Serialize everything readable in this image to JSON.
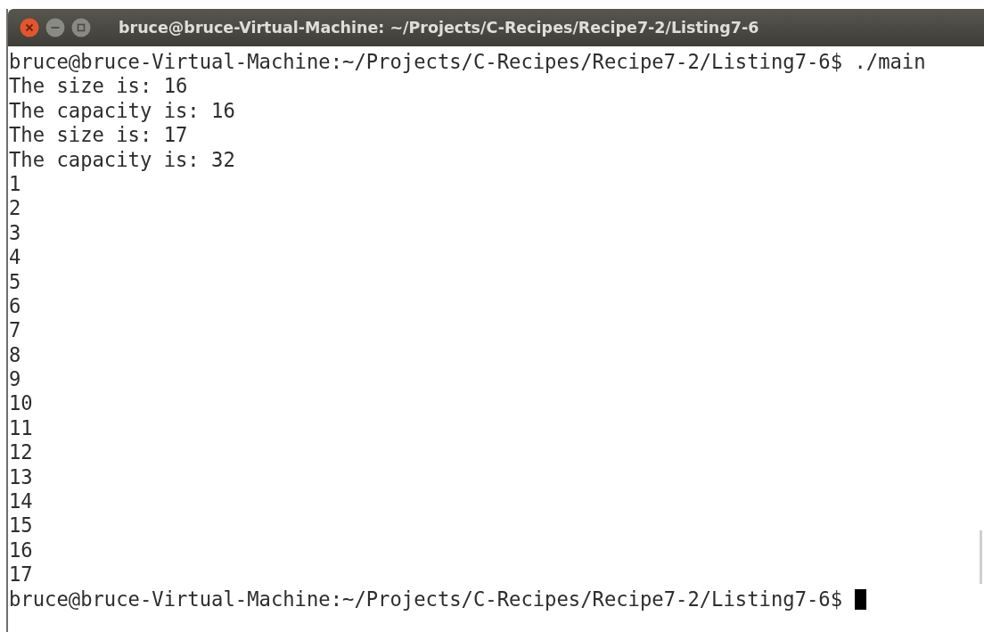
{
  "window": {
    "title": "bruce@bruce-Virtual-Machine: ~/Projects/C-Recipes/Recipe7-2/Listing7-6"
  },
  "terminal": {
    "lines": [
      "bruce@bruce-Virtual-Machine:~/Projects/C-Recipes/Recipe7-2/Listing7-6$ ./main",
      "The size is: 16",
      "The capacity is: 16",
      "The size is: 17",
      "The capacity is: 32",
      "1",
      "2",
      "3",
      "4",
      "5",
      "6",
      "7",
      "8",
      "9",
      "10",
      "11",
      "12",
      "13",
      "14",
      "15",
      "16",
      "17"
    ],
    "prompt": "bruce@bruce-Virtual-Machine:~/Projects/C-Recipes/Recipe7-2/Listing7-6$",
    "cursor": true
  }
}
